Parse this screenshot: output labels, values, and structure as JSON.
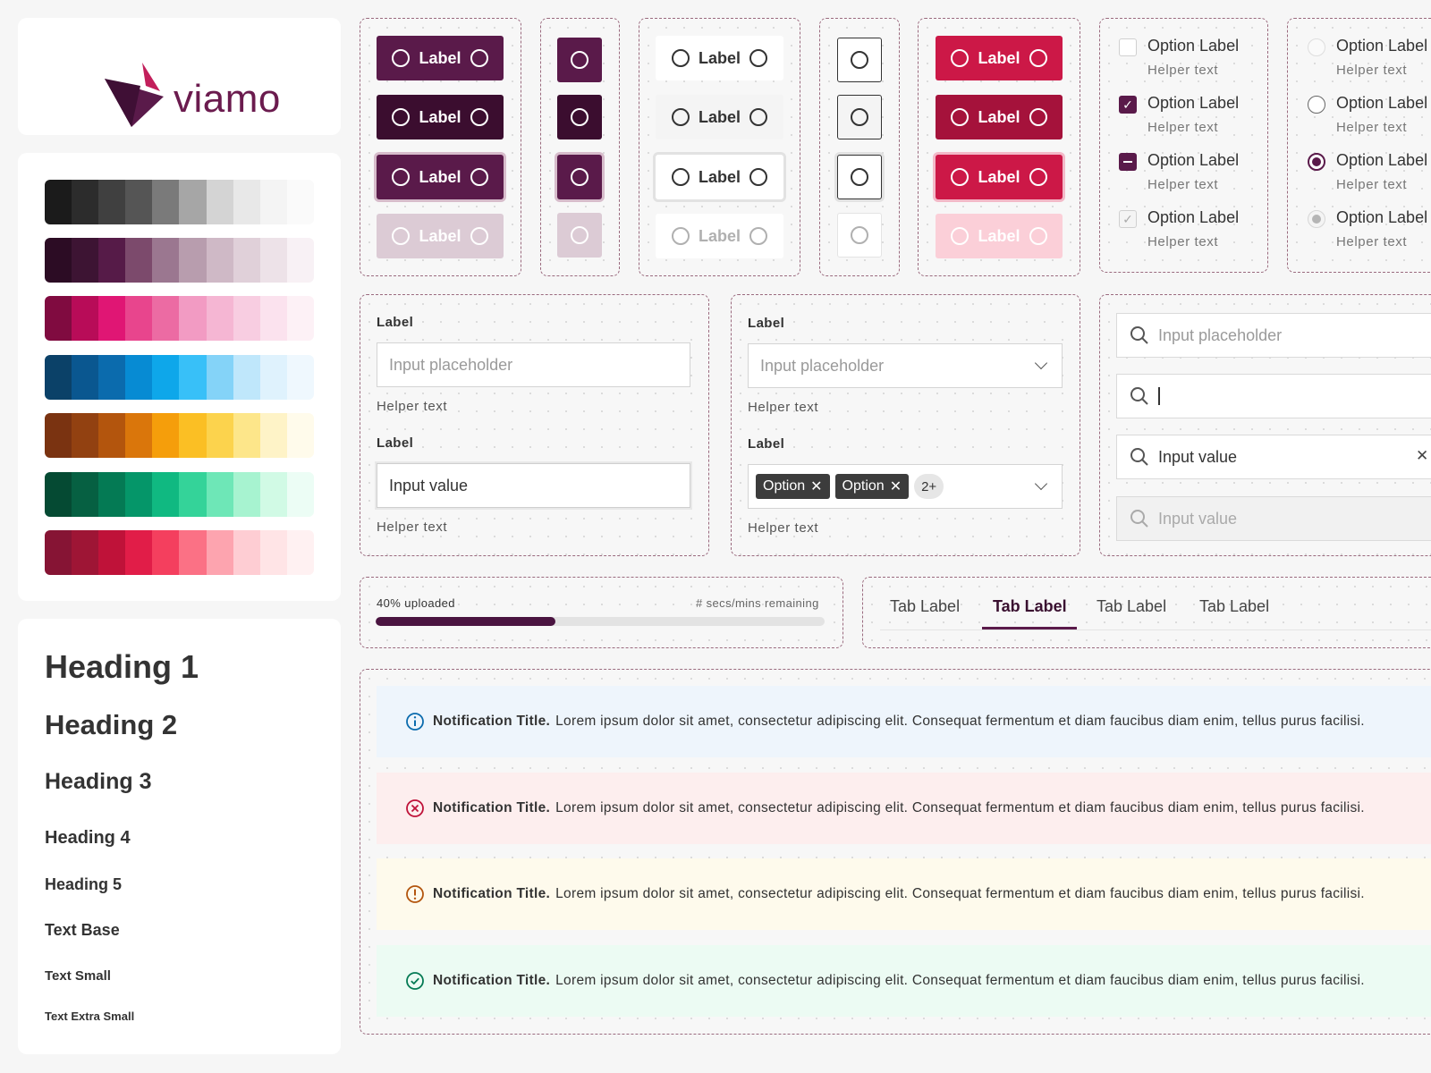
{
  "brand": {
    "name": "viamo",
    "primary_color": "#5a1a4a",
    "accent_color": "#c21f5b"
  },
  "palette": {
    "rows": [
      {
        "name": "neutral",
        "colors": [
          "#1b1b1b",
          "#2c2c2c",
          "#404040",
          "#555555",
          "#7a7a7a",
          "#a6a6a6",
          "#d4d4d4",
          "#e8e8e8",
          "#f4f4f4",
          "#fafafa"
        ]
      },
      {
        "name": "primary",
        "colors": [
          "#2c0c24",
          "#3d1433",
          "#561b48",
          "#7c4a6c",
          "#9b7790",
          "#b89dae",
          "#cfb9c6",
          "#e0d0d9",
          "#ede2e8",
          "#f8f1f5"
        ]
      },
      {
        "name": "pink",
        "colors": [
          "#800b40",
          "#b80c58",
          "#e01674",
          "#e8458d",
          "#ec6ba3",
          "#f29bc3",
          "#f5b6d3",
          "#f8cde1",
          "#fbe2ee",
          "#fdf1f6"
        ]
      },
      {
        "name": "blue",
        "colors": [
          "#0b4168",
          "#0a5790",
          "#0b6bad",
          "#078bd3",
          "#0ea7ea",
          "#38c0f8",
          "#84d3f8",
          "#bfe7fb",
          "#dff2fd",
          "#eff8fe"
        ]
      },
      {
        "name": "amber",
        "colors": [
          "#7a3311",
          "#924111",
          "#b3550d",
          "#da760b",
          "#f59e0b",
          "#fbbf24",
          "#fcd34d",
          "#fde68a",
          "#fef3c7",
          "#fffbeb"
        ]
      },
      {
        "name": "green",
        "colors": [
          "#054a33",
          "#066042",
          "#047a54",
          "#059669",
          "#10b981",
          "#34d399",
          "#6ee7b7",
          "#a7f3d0",
          "#d1fae5",
          "#ecfdf5"
        ]
      },
      {
        "name": "red",
        "colors": [
          "#861434",
          "#9e1535",
          "#bf1239",
          "#e11d48",
          "#f43f5e",
          "#fb7185",
          "#fda4af",
          "#fecdd3",
          "#ffe4e6",
          "#fff1f2"
        ]
      }
    ]
  },
  "typography": {
    "h1": "Heading 1",
    "h2": "Heading 2",
    "h3": "Heading 3",
    "h4": "Heading 4",
    "h5": "Heading 5",
    "base": "Text Base",
    "small": "Text Small",
    "xsmall": "Text Extra Small"
  },
  "buttons": {
    "label": "Label"
  },
  "checkboxes": {
    "items": [
      {
        "label": "Option Label",
        "helper": "Helper text",
        "state": "unchecked"
      },
      {
        "label": "Option Label",
        "helper": "Helper text",
        "state": "checked"
      },
      {
        "label": "Option Label",
        "helper": "Helper text",
        "state": "indeterminate"
      },
      {
        "label": "Option Label",
        "helper": "Helper text",
        "state": "disabled-checked"
      }
    ]
  },
  "radios": {
    "items": [
      {
        "label": "Option Label",
        "helper": "Helper text",
        "state": "disabled"
      },
      {
        "label": "Option Label",
        "helper": "Helper text",
        "state": "unselected"
      },
      {
        "label": "Option Label",
        "helper": "Helper text",
        "state": "selected"
      },
      {
        "label": "Option Label",
        "helper": "Helper text",
        "state": "disabled-selected"
      }
    ]
  },
  "text_inputs": {
    "field1": {
      "label": "Label",
      "placeholder": "Input placeholder",
      "helper": "Helper text"
    },
    "field2": {
      "label": "Label",
      "value": "Input value",
      "helper": "Helper text"
    }
  },
  "selects": {
    "field1": {
      "label": "Label",
      "placeholder": "Input placeholder",
      "helper": "Helper text"
    },
    "field2": {
      "label": "Label",
      "chips": [
        "Option",
        "Option"
      ],
      "more": "2+",
      "helper": "Helper text"
    }
  },
  "search": {
    "placeholder": "Input placeholder",
    "value": "Input value",
    "disabled_value": "Input value"
  },
  "progress": {
    "label": "40% uploaded",
    "remaining": "# secs/mins remaining",
    "percent": 40
  },
  "tabs": {
    "items": [
      "Tab Label",
      "Tab Label",
      "Tab Label",
      "Tab Label"
    ],
    "active_index": 1
  },
  "notifications": [
    {
      "type": "info",
      "title": "Notification Title.",
      "body": "Lorem ipsum dolor sit amet, consectetur adipiscing elit. Consequat fermentum et diam faucibus diam enim, tellus purus facilisi.",
      "bg": "#eef5fc",
      "color": "#0b6bad"
    },
    {
      "type": "error",
      "title": "Notification Title.",
      "body": "Lorem ipsum dolor sit amet, consectetur adipiscing elit. Consequat fermentum et diam faucibus diam enim, tellus purus facilisi.",
      "bg": "#fdeeee",
      "color": "#bf1239"
    },
    {
      "type": "warning",
      "title": "Notification Title.",
      "body": "Lorem ipsum dolor sit amet, consectetur adipiscing elit. Consequat fermentum et diam faucibus diam enim, tellus purus facilisi.",
      "bg": "#fefaec",
      "color": "#b3550d"
    },
    {
      "type": "success",
      "title": "Notification Title.",
      "body": "Lorem ipsum dolor sit amet, consectetur adipiscing elit. Consequat fermentum et diam faucibus diam enim, tellus purus facilisi.",
      "bg": "#ecfbf3",
      "color": "#047a54"
    }
  ]
}
